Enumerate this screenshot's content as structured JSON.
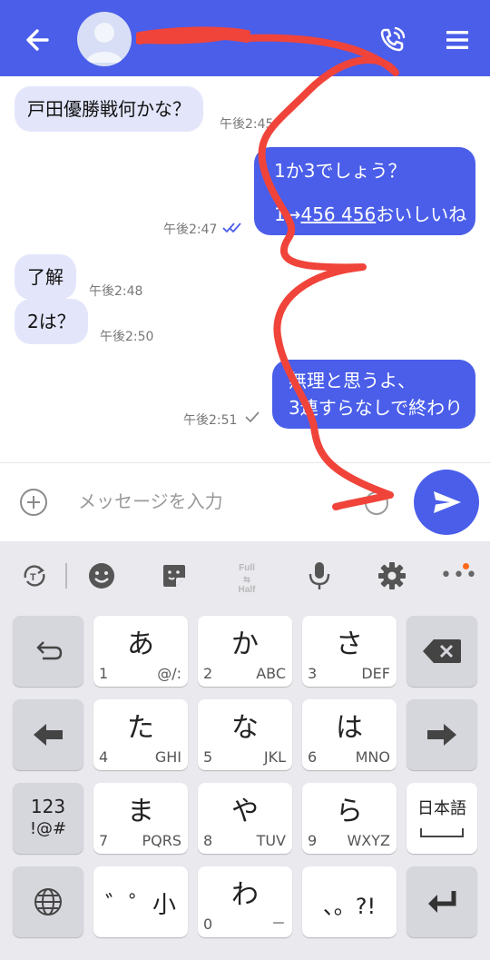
{
  "header": {
    "back_icon": "arrow-left-icon",
    "call_icon": "phone-call-icon",
    "menu_icon": "hamburger-menu-icon",
    "bg_color": "#4a5ee9"
  },
  "messages": [
    {
      "dir": "in",
      "text": "戸田優勝戦何かな？",
      "time": "午後2:45"
    },
    {
      "dir": "out",
      "line1": "1か3でしょう？",
      "line2_prefix": "1→",
      "line2_link": "456 456",
      "line2_suffix": "おいしいね",
      "time": "午後2:47",
      "status": "read"
    },
    {
      "dir": "in",
      "text": "了解",
      "time": "午後2:48"
    },
    {
      "dir": "in",
      "text": "2は？",
      "time": "午後2:50"
    },
    {
      "dir": "out",
      "line1": "無理と思うよ、",
      "line2": "3連すらなしで終わり",
      "time": "午後2:51",
      "status": "sent"
    }
  ],
  "input": {
    "placeholder": "メッセージを入力",
    "value": ""
  },
  "keyboard": {
    "toolbar": {
      "full_label": "Full",
      "half_label": "Half"
    },
    "rows": [
      [
        {
          "name": "key-undo",
          "icon": "undo-icon"
        },
        {
          "name": "key-a",
          "kana": "あ",
          "num": "1",
          "sub": "@/:"
        },
        {
          "name": "key-ka",
          "kana": "か",
          "num": "2",
          "sub": "ABC"
        },
        {
          "name": "key-sa",
          "kana": "さ",
          "num": "3",
          "sub": "DEF"
        },
        {
          "name": "key-backspace",
          "icon": "backspace-icon"
        }
      ],
      [
        {
          "name": "key-left",
          "icon": "arrow-left-icon"
        },
        {
          "name": "key-ta",
          "kana": "た",
          "num": "4",
          "sub": "GHI"
        },
        {
          "name": "key-na",
          "kana": "な",
          "num": "5",
          "sub": "JKL"
        },
        {
          "name": "key-ha",
          "kana": "は",
          "num": "6",
          "sub": "MNO"
        },
        {
          "name": "key-right",
          "icon": "arrow-right-icon"
        }
      ],
      [
        {
          "name": "key-symbols",
          "line1": "123",
          "line2": "!@#"
        },
        {
          "name": "key-ma",
          "kana": "ま",
          "num": "7",
          "sub": "PQRS"
        },
        {
          "name": "key-ya",
          "kana": "や",
          "num": "8",
          "sub": "TUV"
        },
        {
          "name": "key-ra",
          "kana": "ら",
          "num": "9",
          "sub": "WXYZ"
        },
        {
          "name": "key-japanese",
          "label": "日本語",
          "icon": "space-bar-icon"
        }
      ],
      [
        {
          "name": "key-globe",
          "icon": "globe-icon"
        },
        {
          "name": "key-dakuten",
          "label": "゛゜小"
        },
        {
          "name": "key-wa",
          "kana": "わ",
          "num": "0",
          "sub": "－"
        },
        {
          "name": "key-punct",
          "label": "、。?!"
        },
        {
          "name": "key-enter",
          "icon": "enter-icon"
        }
      ]
    ]
  },
  "colors": {
    "accent": "#4a5ee9",
    "incoming_bubble": "#e3e6fb",
    "scribble": "#f0443a",
    "notification_dot": "#ff6a1a"
  }
}
